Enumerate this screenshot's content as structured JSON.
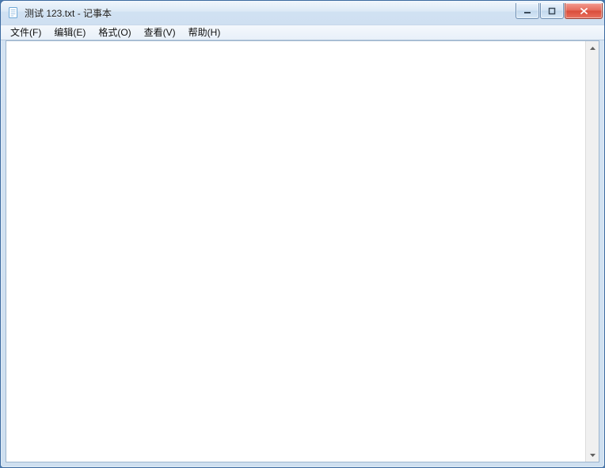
{
  "window": {
    "title": "测试 123.txt - 记事本"
  },
  "menu": {
    "file": "文件(F)",
    "edit": "编辑(E)",
    "format": "格式(O)",
    "view": "查看(V)",
    "help": "帮助(H)"
  },
  "editor": {
    "content": ""
  }
}
